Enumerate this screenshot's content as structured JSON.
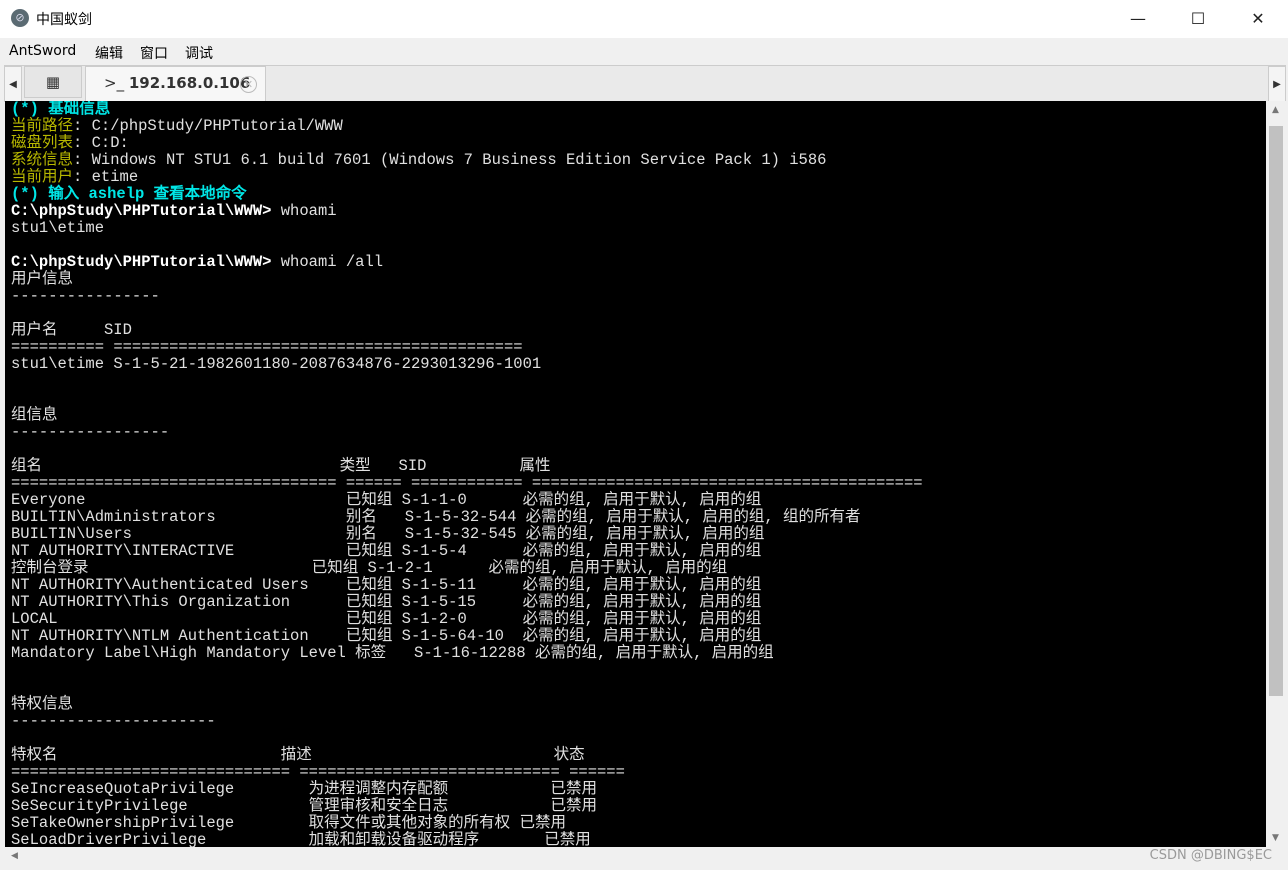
{
  "window": {
    "title": "中国蚁剑",
    "controls": [
      "minimize",
      "maximize",
      "close"
    ]
  },
  "menu": [
    "AntSword",
    "编辑",
    "窗口",
    "调试"
  ],
  "tabs": {
    "active_label": "192.168.0.106",
    "active_icon": "terminal-icon",
    "grid_icon": "grid-icon"
  },
  "terminal": {
    "lines": [
      [
        {
          "t": "(*) 基础信息",
          "c": "cyan"
        }
      ],
      [
        {
          "t": "当前路径",
          "c": "olive"
        },
        {
          "t": ": C:/phpStudy/PHPTutorial/WWW",
          "c": ""
        }
      ],
      [
        {
          "t": "磁盘列表",
          "c": "olive"
        },
        {
          "t": ": C:D:",
          "c": ""
        }
      ],
      [
        {
          "t": "系统信息",
          "c": "olive"
        },
        {
          "t": ": Windows NT STU1 6.1 build 7601 (Windows 7 Business Edition Service Pack 1) i586",
          "c": ""
        }
      ],
      [
        {
          "t": "当前用户",
          "c": "olive"
        },
        {
          "t": ": etime",
          "c": ""
        }
      ],
      [
        {
          "t": "(*) 输入 ashelp 查看本地命令",
          "c": "cyan"
        }
      ],
      [
        {
          "t": "C:\\phpStudy\\PHPTutorial\\WWW> ",
          "c": "bold"
        },
        {
          "t": "whoami",
          "c": ""
        }
      ],
      [
        {
          "t": "stu1\\etime",
          "c": ""
        }
      ],
      [],
      [
        {
          "t": "C:\\phpStudy\\PHPTutorial\\WWW> ",
          "c": "bold"
        },
        {
          "t": "whoami /all",
          "c": ""
        }
      ],
      [
        {
          "t": "用户信息",
          "c": ""
        }
      ],
      [
        {
          "t": "----------------",
          "c": ""
        }
      ],
      [],
      [
        {
          "t": "用户名     SID",
          "c": ""
        }
      ],
      [
        {
          "t": "========== ============================================",
          "c": ""
        }
      ],
      [
        {
          "t": "stu1\\etime S-1-5-21-1982601180-2087634876-2293013296-1001",
          "c": ""
        }
      ],
      [],
      [],
      [
        {
          "t": "组信息",
          "c": ""
        }
      ],
      [
        {
          "t": "-----------------",
          "c": ""
        }
      ],
      [],
      [
        {
          "t": "组名                                类型   SID          属性",
          "c": ""
        }
      ],
      [
        {
          "t": "=================================== ====== ============ ==========================================",
          "c": ""
        }
      ],
      [
        {
          "t": "Everyone                            已知组 S-1-1-0      必需的组, 启用于默认, 启用的组",
          "c": ""
        }
      ],
      [
        {
          "t": "BUILTIN\\Administrators              别名   S-1-5-32-544 必需的组, 启用于默认, 启用的组, 组的所有者",
          "c": ""
        }
      ],
      [
        {
          "t": "BUILTIN\\Users                       别名   S-1-5-32-545 必需的组, 启用于默认, 启用的组",
          "c": ""
        }
      ],
      [
        {
          "t": "NT AUTHORITY\\INTERACTIVE            已知组 S-1-5-4      必需的组, 启用于默认, 启用的组",
          "c": ""
        }
      ],
      [
        {
          "t": "控制台登录                        已知组 S-1-2-1      必需的组, 启用于默认, 启用的组",
          "c": ""
        }
      ],
      [
        {
          "t": "NT AUTHORITY\\Authenticated Users    已知组 S-1-5-11     必需的组, 启用于默认, 启用的组",
          "c": ""
        }
      ],
      [
        {
          "t": "NT AUTHORITY\\This Organization      已知组 S-1-5-15     必需的组, 启用于默认, 启用的组",
          "c": ""
        }
      ],
      [
        {
          "t": "LOCAL                               已知组 S-1-2-0      必需的组, 启用于默认, 启用的组",
          "c": ""
        }
      ],
      [
        {
          "t": "NT AUTHORITY\\NTLM Authentication    已知组 S-1-5-64-10  必需的组, 启用于默认, 启用的组",
          "c": ""
        }
      ],
      [
        {
          "t": "Mandatory Label\\High Mandatory Level 标签   S-1-16-12288 必需的组, 启用于默认, 启用的组",
          "c": ""
        }
      ],
      [],
      [],
      [
        {
          "t": "特权信息",
          "c": ""
        }
      ],
      [
        {
          "t": "----------------------",
          "c": ""
        }
      ],
      [],
      [
        {
          "t": "特权名                        描述                          状态",
          "c": ""
        }
      ],
      [
        {
          "t": "============================== ============================ ======",
          "c": ""
        }
      ],
      [
        {
          "t": "SeIncreaseQuotaPrivilege        为进程调整内存配额           已禁用",
          "c": ""
        }
      ],
      [
        {
          "t": "SeSecurityPrivilege             管理审核和安全日志           已禁用",
          "c": ""
        }
      ],
      [
        {
          "t": "SeTakeOwnershipPrivilege        取得文件或其他对象的所有权 已禁用",
          "c": ""
        }
      ],
      [
        {
          "t": "SeLoadDriverPrivilege           加载和卸载设备驱动程序       已禁用",
          "c": ""
        }
      ]
    ]
  },
  "watermark": "CSDN @DBING$EC",
  "colors": {
    "terminal_bg": "#000000",
    "header": "#00e6e6",
    "label": "#b8b800",
    "text": "#e0e0e0"
  }
}
